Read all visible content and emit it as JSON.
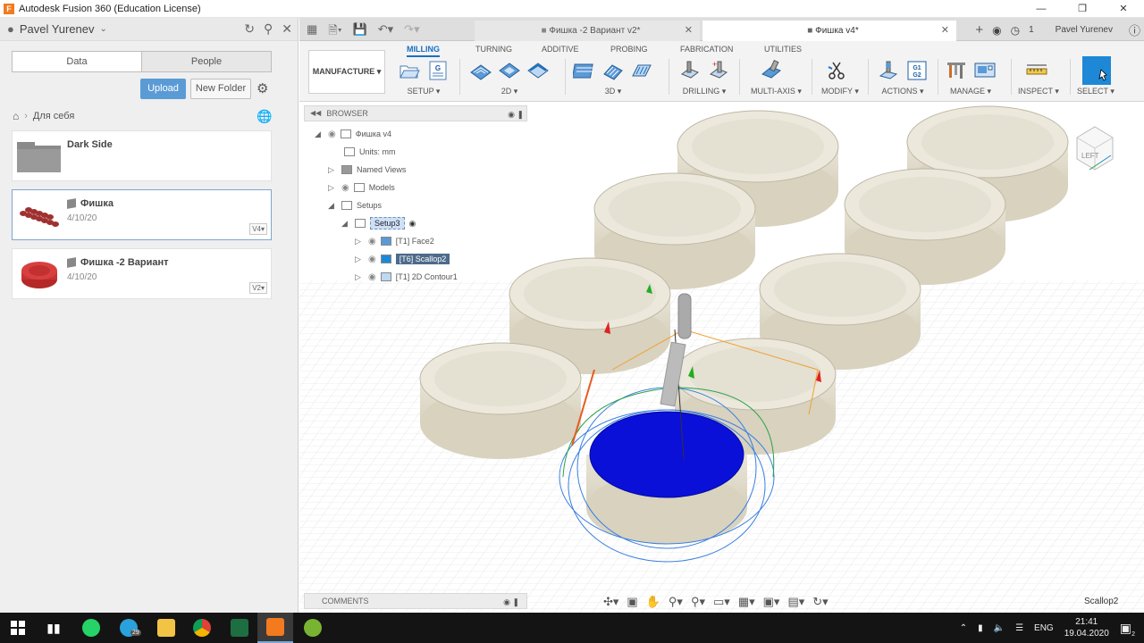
{
  "window": {
    "title": "Autodesk Fusion 360 (Education License)",
    "logo": "F",
    "controls": [
      "—",
      "❐",
      "✕"
    ]
  },
  "data_panel": {
    "user": "Pavel Yurenev",
    "tabs": [
      "Data",
      "People"
    ],
    "upload_label": "Upload",
    "new_folder_label": "New Folder",
    "breadcrumb": "Для себя",
    "items": [
      {
        "name": "Dark Side",
        "date": "",
        "version": ""
      },
      {
        "name": "Фишка",
        "date": "4/10/20",
        "version": "V4▾"
      },
      {
        "name": "Фишка -2 Вариант",
        "date": "4/10/20",
        "version": "V2▾"
      }
    ]
  },
  "doc_tabs": {
    "tab1": "Фишка -2 Вариант v2*",
    "tab2": "Фишка v4*",
    "close": "✕",
    "job_count": "1",
    "user": "Pavel Yurenev"
  },
  "toolbar": {
    "workspace": "MANUFACTURE ▾",
    "tabs": [
      "MILLING",
      "TURNING",
      "ADDITIVE",
      "PROBING",
      "FABRICATION",
      "UTILITIES"
    ],
    "groups": [
      "SETUP ▾",
      "2D ▾",
      "3D ▾",
      "DRILLING ▾",
      "MULTI-AXIS ▾",
      "MODIFY ▾",
      "ACTIONS ▾",
      "MANAGE ▾",
      "INSPECT ▾",
      "SELECT ▾"
    ],
    "gcode_label": "G1 G2"
  },
  "browser": {
    "title": "BROWSER",
    "nodes": [
      {
        "label": "Фишка v4"
      },
      {
        "label": "Units: mm"
      },
      {
        "label": "Named Views"
      },
      {
        "label": "Models"
      },
      {
        "label": "Setups"
      },
      {
        "label": "Setup3"
      },
      {
        "label": "[T1] Face2"
      },
      {
        "label": "[T6] Scallop2"
      },
      {
        "label": "[T1] 2D Contour1"
      }
    ]
  },
  "viewcube": {
    "label": "LEFT"
  },
  "comments": {
    "title": "COMMENTS"
  },
  "status": {
    "operation": "Scallop2"
  },
  "taskbar": {
    "telegram_badge": "29",
    "lang": "ENG",
    "time": "21:41",
    "date": "19.04.2020",
    "notif_count": "2"
  }
}
